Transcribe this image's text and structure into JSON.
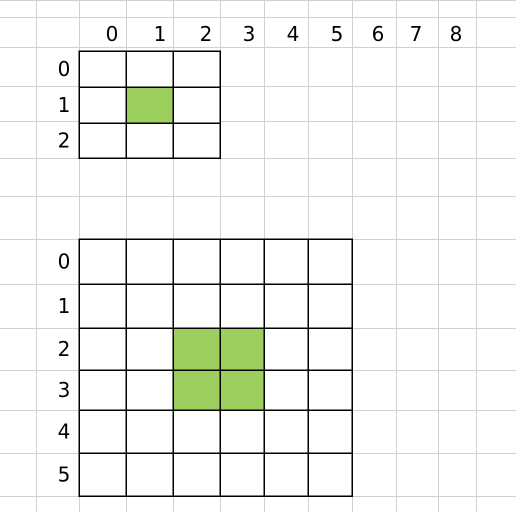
{
  "colors": {
    "background": "#ffffff",
    "gridline": "#d0d0d0",
    "cell_border": "#000000",
    "highlight": "#9ccf5e"
  },
  "column_headers": [
    "0",
    "1",
    "2",
    "3",
    "4",
    "5",
    "6",
    "7",
    "8"
  ],
  "small_grid": {
    "rows": 3,
    "cols": 3,
    "row_labels": [
      "0",
      "1",
      "2"
    ],
    "highlighted_cells": [
      [
        1,
        1
      ]
    ]
  },
  "large_grid": {
    "rows": 6,
    "cols": 6,
    "row_labels": [
      "0",
      "1",
      "2",
      "3",
      "4",
      "5"
    ],
    "highlighted_cells": [
      [
        2,
        2
      ],
      [
        2,
        3
      ],
      [
        3,
        2
      ],
      [
        3,
        3
      ]
    ]
  }
}
